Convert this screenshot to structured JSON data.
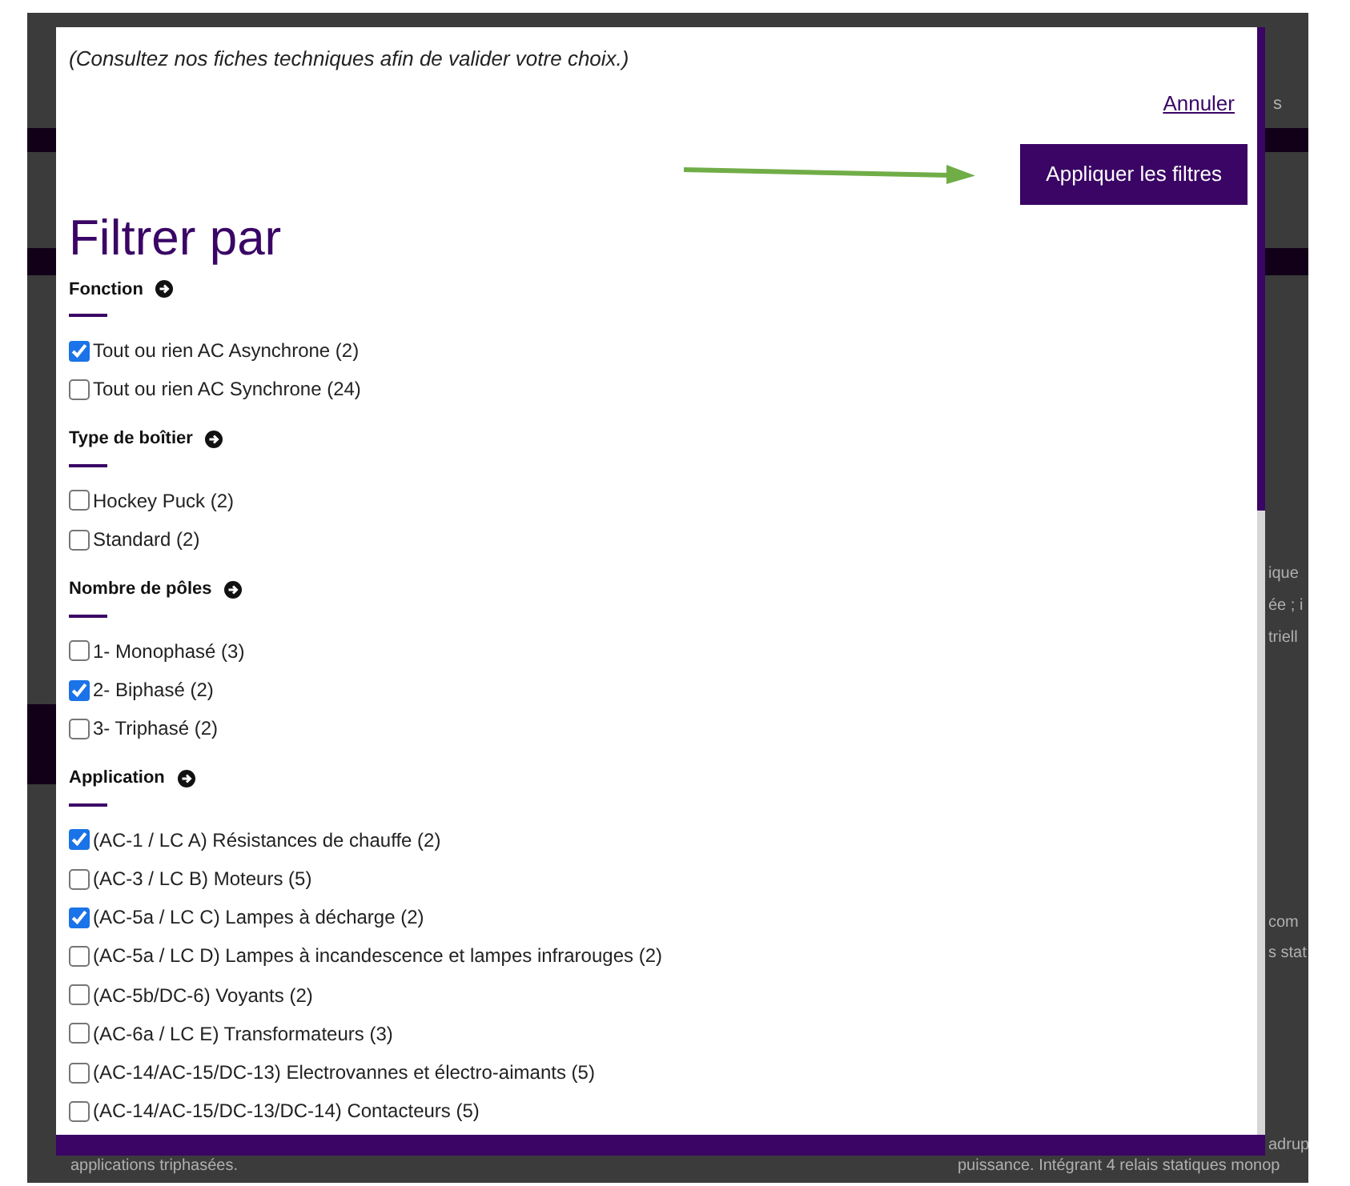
{
  "background": {
    "texts": [
      "s",
      "ique",
      "ée ; i",
      "triell",
      "com",
      "s stat",
      "adrup",
      "applications triphasées.",
      "puissance. Intégrant 4 relais statiques monop"
    ]
  },
  "modal": {
    "note": "(Consultez nos fiches techniques afin de valider votre choix.)",
    "cancel": "Annuler",
    "apply": "Appliquer les filtres",
    "title": "Filtrer par",
    "groups": [
      {
        "heading": "Fonction",
        "options": [
          {
            "label": "Tout ou rien AC Asynchrone (2)",
            "checked": true
          },
          {
            "label": "Tout ou rien AC Synchrone (24)",
            "checked": false
          }
        ]
      },
      {
        "heading": "Type de boîtier",
        "options": [
          {
            "label": "Hockey Puck (2)",
            "checked": false
          },
          {
            "label": "Standard (2)",
            "checked": false
          }
        ]
      },
      {
        "heading": "Nombre de pôles",
        "options": [
          {
            "label": "1- Monophasé (3)",
            "checked": false
          },
          {
            "label": "2- Biphasé (2)",
            "checked": true
          },
          {
            "label": "3- Triphasé (2)",
            "checked": false
          }
        ]
      },
      {
        "heading": "Application",
        "options": [
          {
            "label": "(AC-1 / LC A) Résistances de chauffe (2)",
            "checked": true
          },
          {
            "label": "(AC-3 / LC B) Moteurs (5)",
            "checked": false
          },
          {
            "label": "(AC-5a / LC C) Lampes à décharge (2)",
            "checked": true
          },
          {
            "label": "(AC-5a / LC D) Lampes à incandescence et lampes infrarouges (2)",
            "checked": false
          },
          {
            "label": "(AC-5b/DC-6) Voyants (2)",
            "checked": false
          },
          {
            "label": "(AC-6a / LC E) Transformateurs (3)",
            "checked": false
          },
          {
            "label": "(AC-14/AC-15/DC-13) Electrovannes et électro-aimants (5)",
            "checked": false
          },
          {
            "label": "(AC-14/AC-15/DC-13/DC-14) Contacteurs (5)",
            "checked": false
          }
        ]
      }
    ]
  }
}
